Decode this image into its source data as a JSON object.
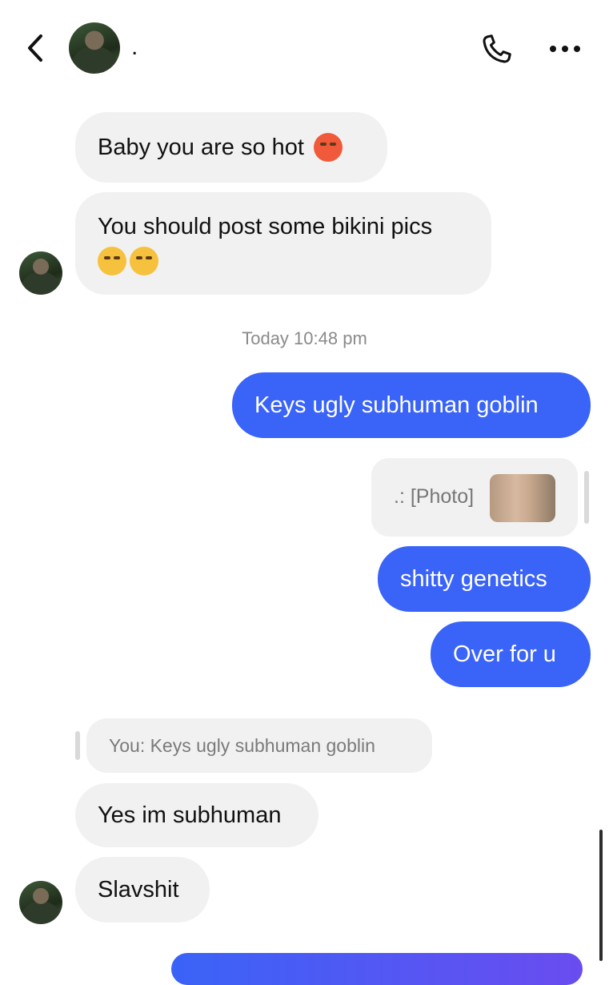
{
  "header": {
    "contact_name": ".",
    "icons": {
      "back": "chevron-left-icon",
      "call": "phone-icon",
      "more": "more-horizontal-icon"
    }
  },
  "messages": {
    "in_1": "Baby you are so hot",
    "in_2": "You should post some bikini pics",
    "timestamp": "Today 10:48 pm",
    "out_1": "Keys ugly subhuman goblin",
    "reply_photo_label": ".: [Photo]",
    "out_2": "shitty genetics",
    "out_3": "Over for u",
    "quoted_reply": "You: Keys ugly subhuman goblin",
    "in_3": "Yes im subhuman",
    "in_4": "Slavshit"
  },
  "colors": {
    "outgoing": "#3a63f7",
    "incoming": "#f1f1f1"
  }
}
